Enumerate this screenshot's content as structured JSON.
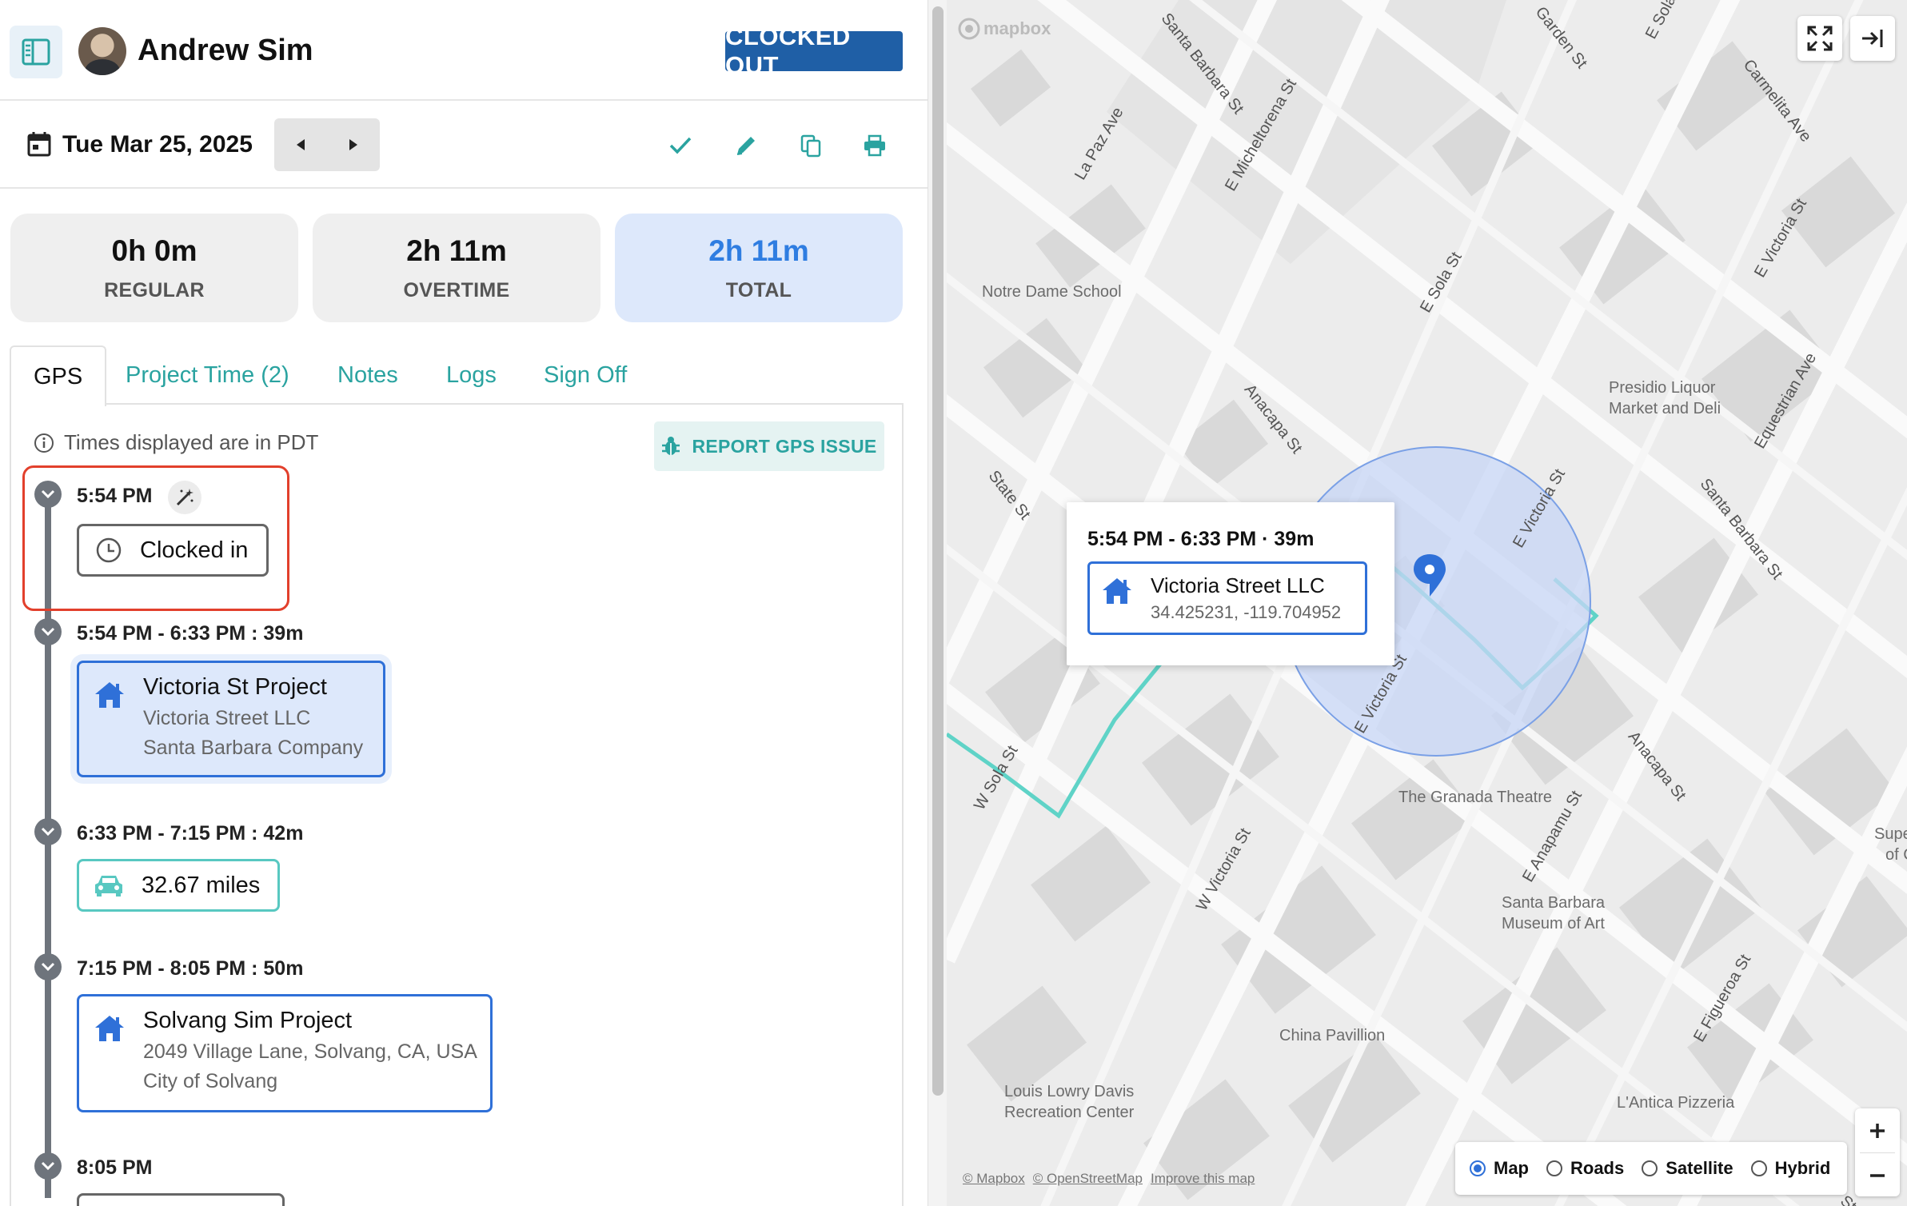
{
  "header": {
    "user_name": "Andrew Sim",
    "status_badge": "CLOCKED OUT"
  },
  "datebar": {
    "date": "Tue Mar 25, 2025"
  },
  "stats": [
    {
      "value": "0h 0m",
      "label": "REGULAR"
    },
    {
      "value": "2h 11m",
      "label": "OVERTIME"
    },
    {
      "value": "2h 11m",
      "label": "TOTAL"
    }
  ],
  "tabs": [
    "GPS",
    "Project Time (2)",
    "Notes",
    "Logs",
    "Sign Off"
  ],
  "gps": {
    "timezone_note": "Times displayed are in PDT",
    "report_button": "REPORT GPS ISSUE",
    "timeline": [
      {
        "time": "5:54 PM",
        "card_title": "Clocked in"
      },
      {
        "time": "5:54 PM - 6:33 PM : 39m",
        "card_title": "Victoria St Project",
        "line1": "Victoria Street LLC",
        "line2": "Santa Barbara Company"
      },
      {
        "time": "6:33 PM - 7:15 PM : 42m",
        "card_title": "32.67 miles"
      },
      {
        "time": "7:15 PM - 8:05 PM : 50m",
        "card_title": "Solvang Sim Project",
        "line1": "2049 Village Lane, Solvang, CA, USA",
        "line2": "City of Solvang"
      },
      {
        "time": "8:05 PM"
      }
    ]
  },
  "map": {
    "logo": "mapbox",
    "popup": {
      "time": "5:54 PM - 6:33 PM · 39m",
      "title": "Victoria Street LLC",
      "coords": "34.425231, -119.704952"
    },
    "places": [
      "Notre Dame School",
      "Presidio Liquor",
      "Market and Deli",
      "The Granada Theatre",
      "Santa Barbara",
      "Museum of Art",
      "China Pavillion",
      "Louis Lowry Davis",
      "Recreation Center",
      "L'Antica Pizzeria",
      "Supe",
      "of C"
    ],
    "streets": [
      "Santa Barbara St",
      "Garden St",
      "E Sola St",
      "Carmelita Ave",
      "La Paz Ave",
      "E Micheltorena St",
      "E Victoria St",
      "E Sola St",
      "Equestrian Ave",
      "Anacapa St",
      "State St",
      "E Victoria St",
      "Santa Barbara St",
      "E Victoria St",
      "W Sola St",
      "Anacapa St",
      "E Anapamu St",
      "W Victoria St",
      "E Figueroa St",
      "Ste"
    ],
    "map_types": [
      "Map",
      "Roads",
      "Satellite",
      "Hybrid"
    ],
    "selected_map_type": "Map",
    "attribution": [
      "© Mapbox",
      "© OpenStreetMap",
      "Improve this map"
    ],
    "colors": {
      "route": "#5fd3c7",
      "geofence_fill": "#c7d6f5",
      "geofence_stroke": "#7aa0e6",
      "pin": "#2f70d8"
    }
  },
  "colors": {
    "accent_teal": "#2aa3a0",
    "accent_blue": "#2f70d8",
    "badge_blue": "#1f5fa6",
    "highlight_red": "#e2402c"
  }
}
